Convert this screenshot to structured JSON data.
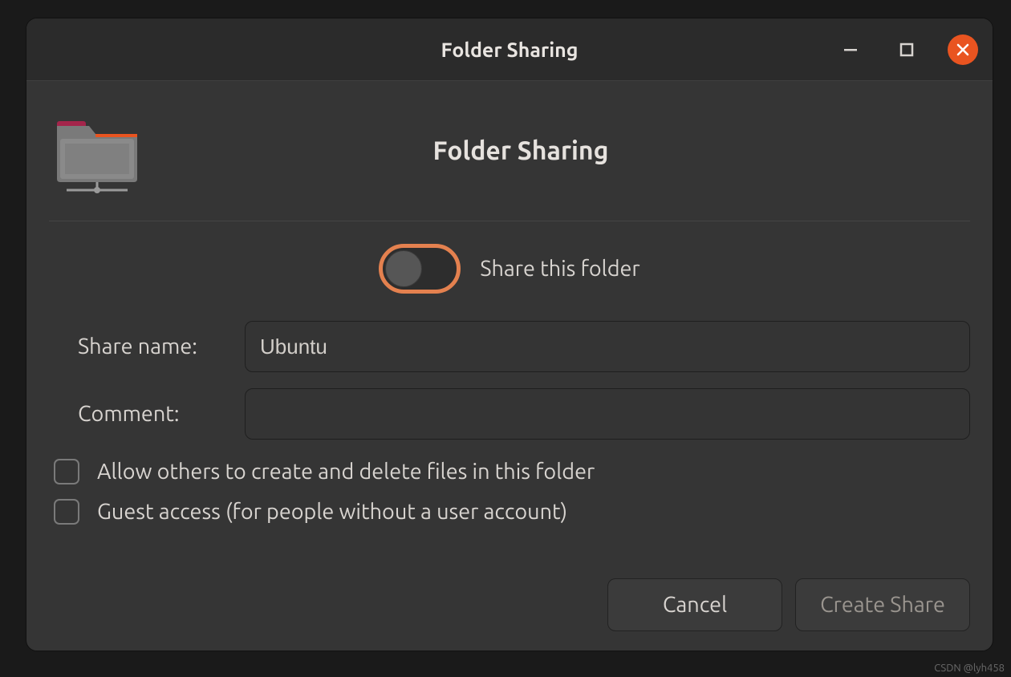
{
  "titlebar": {
    "title": "Folder Sharing"
  },
  "header": {
    "title": "Folder Sharing"
  },
  "toggle": {
    "share_label": "Share this folder",
    "on": false
  },
  "form": {
    "share_name_label": "Share name:",
    "share_name_value": "Ubuntu",
    "comment_label": "Comment:",
    "comment_value": ""
  },
  "checkboxes": {
    "allow_write_label": "Allow others to create and delete files in this folder",
    "allow_write_checked": false,
    "guest_access_label": "Guest access (for people without a user account)",
    "guest_access_checked": false
  },
  "buttons": {
    "cancel_label": "Cancel",
    "create_label": "Create Share"
  },
  "watermark": "CSDN @lyh458"
}
